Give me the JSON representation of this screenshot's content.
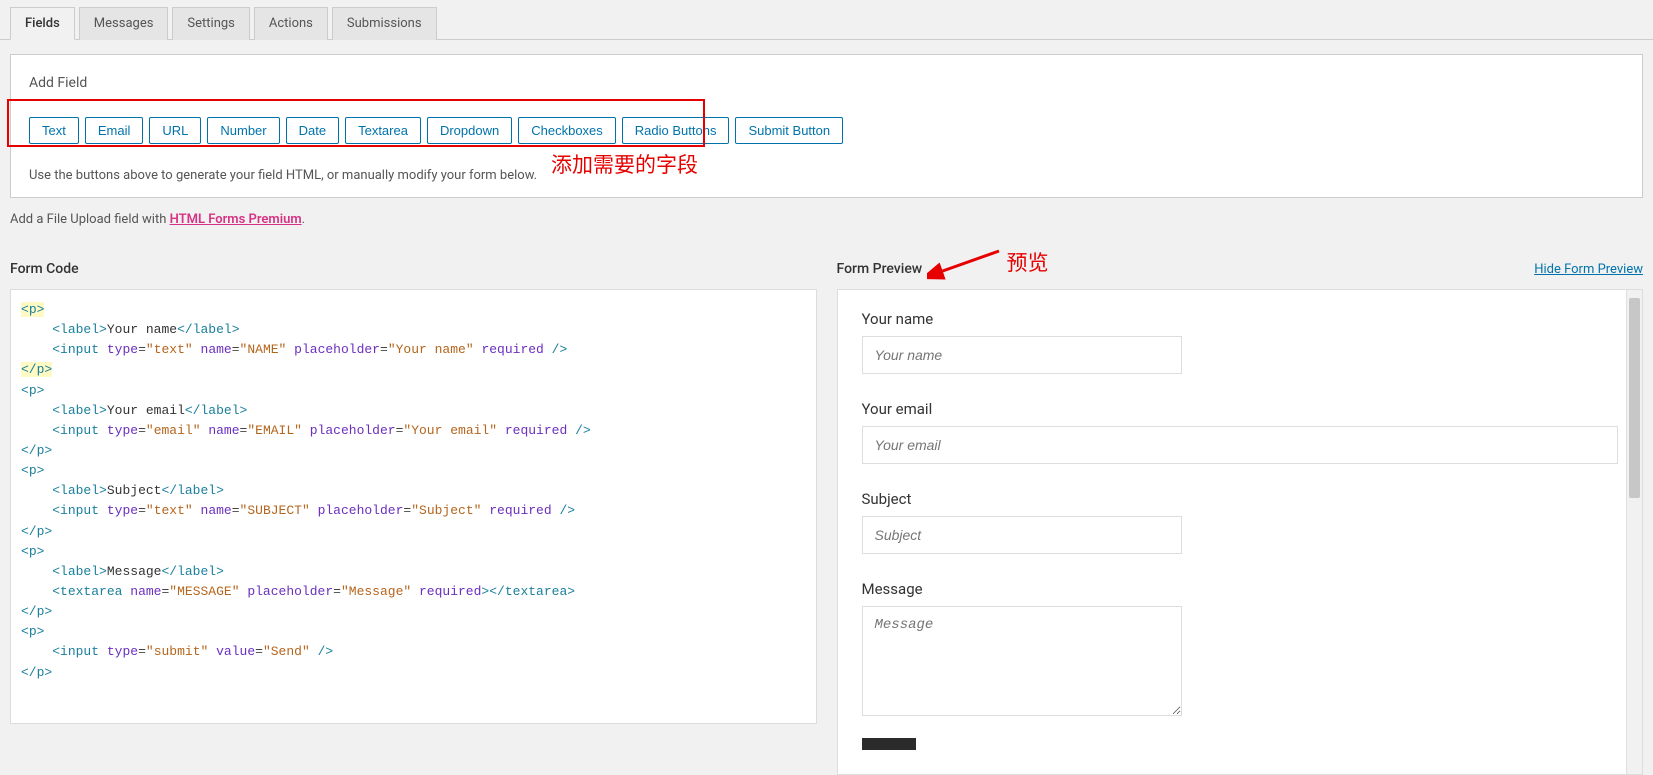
{
  "tabs": {
    "items": [
      {
        "label": "Fields",
        "active": true
      },
      {
        "label": "Messages",
        "active": false
      },
      {
        "label": "Settings",
        "active": false
      },
      {
        "label": "Actions",
        "active": false
      },
      {
        "label": "Submissions",
        "active": false
      }
    ]
  },
  "add_field": {
    "title": "Add Field",
    "buttons": [
      "Text",
      "Email",
      "URL",
      "Number",
      "Date",
      "Textarea",
      "Dropdown",
      "Checkboxes",
      "Radio Buttons",
      "Submit Button"
    ],
    "hint": "Use the buttons above to generate your field HTML, or manually modify your form below.",
    "annotation": "添加需要的字段"
  },
  "upload_note": {
    "prefix": "Add a File Upload field with ",
    "link": "HTML Forms Premium",
    "suffix": "."
  },
  "form_code": {
    "title": "Form Code",
    "lines": [
      "<p>",
      "    <label>Your name</label>",
      "    <input type=\"text\" name=\"NAME\" placeholder=\"Your name\" required />",
      "</p>",
      "<p>",
      "    <label>Your email</label>",
      "    <input type=\"email\" name=\"EMAIL\" placeholder=\"Your email\" required />",
      "</p>",
      "<p>",
      "    <label>Subject</label>",
      "    <input type=\"text\" name=\"SUBJECT\" placeholder=\"Subject\" required />",
      "</p>",
      "<p>",
      "    <label>Message</label>",
      "    <textarea name=\"MESSAGE\" placeholder=\"Message\" required></textarea>",
      "</p>",
      "<p>",
      "    <input type=\"submit\" value=\"Send\" />",
      "</p>"
    ]
  },
  "form_preview": {
    "title": "Form Preview",
    "hide_link": "Hide Form Preview",
    "annotation": "预览",
    "fields": [
      {
        "label": "Your name",
        "placeholder": "Your name",
        "type": "text",
        "wide": false
      },
      {
        "label": "Your email",
        "placeholder": "Your email",
        "type": "text",
        "wide": true
      },
      {
        "label": "Subject",
        "placeholder": "Subject",
        "type": "text",
        "wide": false
      },
      {
        "label": "Message",
        "placeholder": "Message",
        "type": "textarea",
        "wide": false
      }
    ]
  }
}
